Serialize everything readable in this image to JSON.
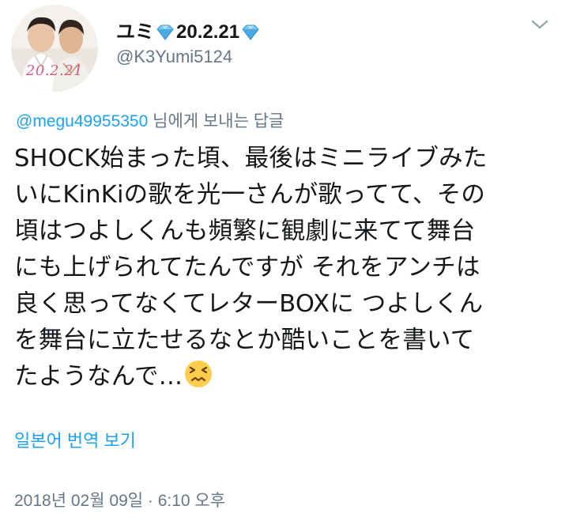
{
  "profile": {
    "avatar_label": "20.2.21",
    "display_name_prefix": "ユミ",
    "display_name_middle": "20.2.21",
    "handle": "@K3Yumi5124"
  },
  "icons": {
    "menu": "chevron-down-icon",
    "name_decoration": "gem-icon",
    "emoji": "confounded-face-icon"
  },
  "reply": {
    "mention": "@megu49955350",
    "suffix": " 님에게 보내는 답글"
  },
  "tweet": {
    "lines": [
      "SHOCK始まった頃、最後はミニライブみた",
      "いにKinKiの歌を光一さんが歌ってて、その",
      "頃はつよしくんも頻繁に観劇に来てて舞台",
      "にも上げられてたんですが それをアンチは",
      "良く思ってなくてレターBOXに つよしくん",
      "を舞台に立たせるなとか酷いことを書いて",
      "たようなんで…"
    ]
  },
  "translate": {
    "label": "일본어 번역 보기"
  },
  "meta": {
    "timestamp": "2018년 02월 09일 · 6:10 오후"
  },
  "colors": {
    "link": "#1da1f2",
    "secondary_text": "#657786",
    "primary_text": "#14171a",
    "avatar_date": "#d8587b"
  }
}
